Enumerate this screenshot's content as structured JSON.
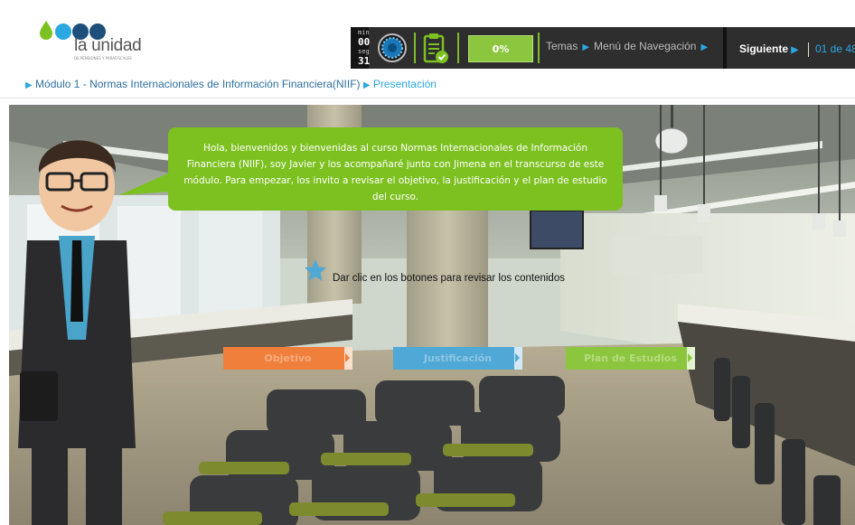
{
  "brand": {
    "name": "la unidad",
    "tagline": "DE PENSIONES Y PARAFISCALES",
    "colors": [
      "#7dc121",
      "#2aa8e0",
      "#1e4f7a",
      "#2f6f9e"
    ]
  },
  "topbar": {
    "timer": {
      "min_label": "min",
      "min_value": "00",
      "seg_label": "seg",
      "seg_value": "31"
    },
    "progress": {
      "value": 0,
      "label": "0%"
    },
    "topics_label": "Temas",
    "nav_menu_label": "Menú de Navegación",
    "next_label": "Siguiente",
    "page_counter": "01 de 48",
    "icons": [
      "stopwatch-icon",
      "clipboard-check-icon"
    ]
  },
  "breadcrumb": {
    "module": "Módulo 1 - Normas Internacionales de Información Financiera(NIIF)",
    "section": "Presentación"
  },
  "scene": {
    "bubble_text": "Hola, bienvenidos y bienvenidas al curso Normas Internacionales de Información Financiera (NIIF), soy Javier y los acompañaré junto con Jimena en el transcurso de este módulo. Para empezar, los invito a revisar el objetivo, la justificación y el plan de estudio del curso.",
    "instruction": "Dar clic en los botones para revisar los contenidos",
    "buttons": [
      {
        "label": "Objetivo",
        "color": "#f07f3b"
      },
      {
        "label": "Justificación",
        "color": "#4fa8d5"
      },
      {
        "label": "Plan de Estudios",
        "color": "#8cc63e"
      }
    ]
  }
}
